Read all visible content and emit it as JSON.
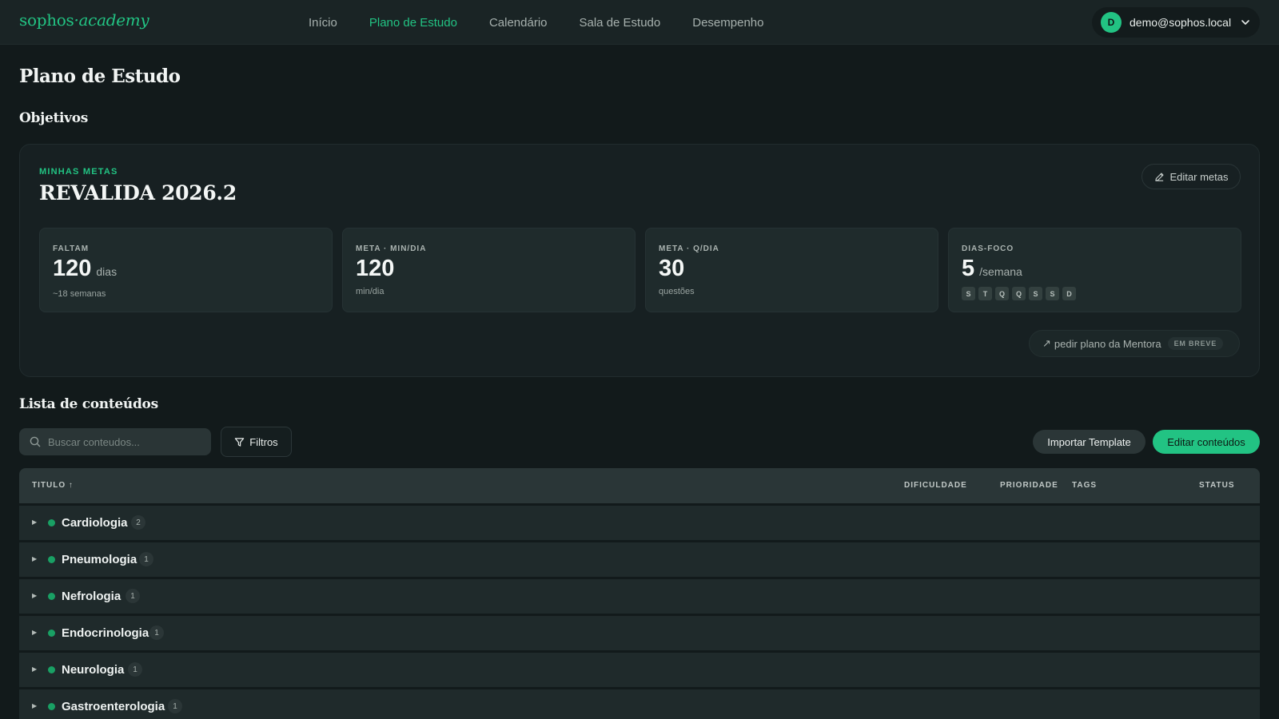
{
  "brand": {
    "part1": "sophos",
    "part2": "·academy"
  },
  "nav": {
    "links": [
      "Início",
      "Plano de Estudo",
      "Calendário",
      "Sala de Estudo",
      "Desempenho"
    ],
    "active_index": 1
  },
  "user": {
    "initial": "D",
    "email": "demo@sophos.local"
  },
  "page": {
    "title": "Plano de Estudo"
  },
  "objectives": {
    "section_title": "Objetivos",
    "eyebrow": "MINHAS METAS",
    "goal_name": "REVALIDA 2026.2",
    "edit_label": "Editar metas",
    "stats": [
      {
        "label": "FALTAM",
        "value": "120",
        "unit": "dias",
        "sub": "~18 semanas"
      },
      {
        "label": "META · MIN/DIA",
        "value": "120",
        "unit": "",
        "sub": "min/dia"
      },
      {
        "label": "META · Q/DIA",
        "value": "30",
        "unit": "",
        "sub": "questões"
      },
      {
        "label": "DIAS-FOCO",
        "value": "5",
        "unit": "/semana",
        "days": [
          "S",
          "T",
          "Q",
          "Q",
          "S",
          "S",
          "D"
        ]
      }
    ],
    "mentor": {
      "arrow": "↗",
      "label": "pedir plano da Mentora",
      "badge": "EM BREVE"
    }
  },
  "contents": {
    "section_title": "Lista de conteúdos",
    "search_placeholder": "Buscar conteudos...",
    "filter_label": "Filtros",
    "import_label": "Importar Template",
    "edit_label": "Editar conteúdos",
    "columns": {
      "title": "TITULO ↑",
      "difficulty": "DIFICULDADE",
      "priority": "PRIORIDADE",
      "tags": "TAGS",
      "status": "STATUS"
    },
    "rows": [
      {
        "arrow": "▶",
        "title": "Cardiologia",
        "count": "2"
      },
      {
        "arrow": "▶",
        "title": "Pneumologia",
        "count": "1"
      },
      {
        "arrow": "▶",
        "title": "Nefrologia",
        "count": "1"
      },
      {
        "arrow": "▶",
        "title": "Endocrinologia",
        "count": "1"
      },
      {
        "arrow": "▶",
        "title": "Neurologia",
        "count": "1"
      },
      {
        "arrow": "▶",
        "title": "Gastroenterologia",
        "count": "1"
      }
    ]
  },
  "colors": {
    "accent": "#22c383",
    "background": "#121a1b",
    "status_dot": "#19a064"
  }
}
